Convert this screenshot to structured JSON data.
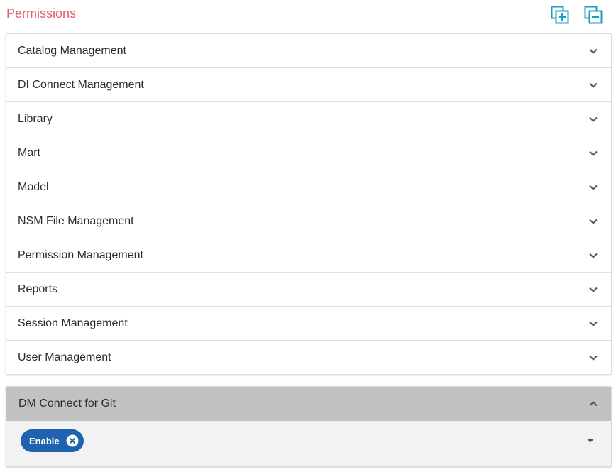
{
  "header": {
    "title": "Permissions",
    "expand_all_icon": "expand-all-icon",
    "collapse_all_icon": "collapse-all-icon",
    "accent_color": "#1e9ec7",
    "title_color": "#e0606b"
  },
  "permission_groups": [
    {
      "label": "Catalog Management"
    },
    {
      "label": "DI Connect Management"
    },
    {
      "label": "Library"
    },
    {
      "label": "Mart"
    },
    {
      "label": "Model"
    },
    {
      "label": "NSM File Management"
    },
    {
      "label": "Permission Management"
    },
    {
      "label": "Reports"
    },
    {
      "label": "Session Management"
    },
    {
      "label": "User Management"
    }
  ],
  "git_section": {
    "title": "DM Connect for Git",
    "expanded": true,
    "selected_chips": [
      {
        "label": "Enable"
      }
    ],
    "chip_color": "#1e62b0"
  }
}
